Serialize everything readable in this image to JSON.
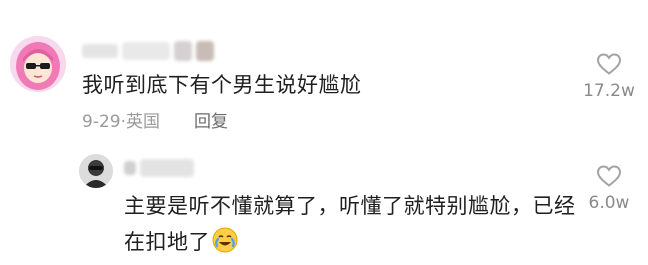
{
  "comments": [
    {
      "text": "我听到底下有个男生说好尴尬",
      "date": "9-29",
      "separator": "·",
      "region": "英国",
      "reply_label": "回复",
      "likes": "17.2w",
      "avatar_icon": "girl-avatar-pink-hair-sunglasses"
    }
  ],
  "replies": [
    {
      "text": "主要是听不懂就算了，听懂了就特别尴尬，已经在扣地了",
      "emoji_icon": "crying-laughing-emoji",
      "likes": "6.0w",
      "avatar_icon": "dark-avatar"
    }
  ],
  "colors": {
    "text": "#1f1f1f",
    "meta": "#9a9a9a",
    "like": "#8a8a8a"
  }
}
